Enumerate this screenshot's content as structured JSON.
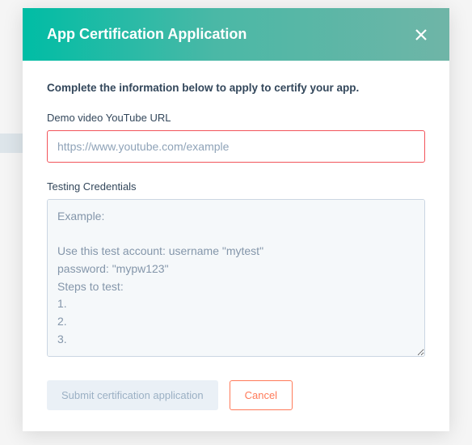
{
  "modal": {
    "title": "App Certification Application",
    "intro": "Complete the information below to apply to certify your app.",
    "fields": {
      "demo_url": {
        "label": "Demo video YouTube URL",
        "placeholder": "https://www.youtube.com/example",
        "value": ""
      },
      "testing_credentials": {
        "label": "Testing Credentials",
        "placeholder": "Example:\n\nUse this test account: username \"mytest\"\npassword: \"mypw123\"\nSteps to test:\n1.\n2.\n3.",
        "value": ""
      }
    },
    "buttons": {
      "submit": "Submit certification application",
      "cancel": "Cancel"
    }
  }
}
